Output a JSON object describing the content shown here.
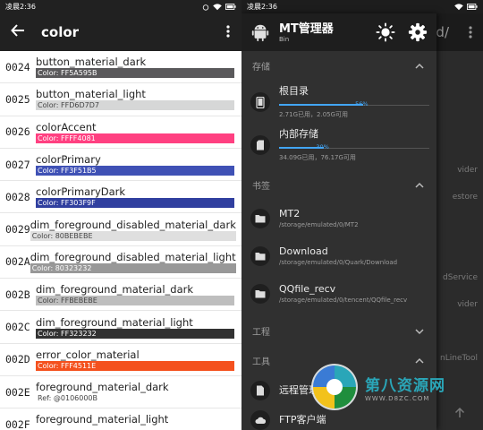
{
  "left": {
    "status": {
      "time": "凌晨2:36",
      "battery": "▮"
    },
    "toolbar": {
      "title": "color"
    },
    "rows": [
      {
        "code": "0024",
        "name": "button_material_dark",
        "label": "Color: FF5A595B",
        "color": "#5A595B"
      },
      {
        "code": "0025",
        "name": "button_material_light",
        "label": "Color: FFD6D7D7",
        "color": "#D6D7D7",
        "dark": true
      },
      {
        "code": "0026",
        "name": "colorAccent",
        "label": "Color: FFFF4081",
        "color": "#FF4081"
      },
      {
        "code": "0027",
        "name": "colorPrimary",
        "label": "Color: FF3F51B5",
        "color": "#3F51B5"
      },
      {
        "code": "0028",
        "name": "colorPrimaryDark",
        "label": "Color: FF303F9F",
        "color": "#303F9F"
      },
      {
        "code": "0029",
        "name": "dim_foreground_disabled_material_dark",
        "label": "Color: 80BEBEBE",
        "color": "#DFDFDF",
        "dark": true
      },
      {
        "code": "002A",
        "name": "dim_foreground_disabled_material_light",
        "label": "Color: 80323232",
        "color": "#989898"
      },
      {
        "code": "002B",
        "name": "dim_foreground_material_dark",
        "label": "Color: FFBEBEBE",
        "color": "#BEBEBE",
        "dark": true
      },
      {
        "code": "002C",
        "name": "dim_foreground_material_light",
        "label": "Color: FF323232",
        "color": "#323232"
      },
      {
        "code": "002D",
        "name": "error_color_material",
        "label": "Color: FFF4511E",
        "color": "#F4511E"
      },
      {
        "code": "002E",
        "name": "foreground_material_dark",
        "label": "Ref: @0106000B",
        "color": "transparent",
        "dark": true
      },
      {
        "code": "002F",
        "name": "foreground_material_light",
        "label": "",
        "color": "transparent"
      }
    ]
  },
  "right": {
    "status": {
      "time": "凌晨2:36"
    },
    "bg_title_fragment": "d/",
    "bg_fragments": [
      "vider",
      "estore",
      "dService",
      "vider",
      "nLineTool"
    ],
    "header": {
      "app_name": "MT管理器",
      "app_sub": "Bin"
    },
    "sections": {
      "storage": "存储",
      "bookmarks": "书签",
      "project": "工程",
      "tools": "工具"
    },
    "storage": [
      {
        "title": "根目录",
        "sub": "2.71G已用，2.05G可用",
        "percent": 56,
        "pct_label": "56%"
      },
      {
        "title": "内部存储",
        "sub": "34.09G已用，76.17G可用",
        "percent": 30,
        "pct_label": "30%"
      }
    ],
    "bookmarks": [
      {
        "title": "MT2",
        "path": "/storage/emulated/0/MT2"
      },
      {
        "title": "Download",
        "path": "/storage/emulated/0/Quark/Download"
      },
      {
        "title": "QQfile_recv",
        "path": "/storage/emulated/0/tencent/QQfile_recv"
      }
    ],
    "tools": [
      {
        "title": "远程管理"
      },
      {
        "title": "FTP客户端"
      }
    ],
    "watermark": {
      "main": "第八资源网",
      "url": "WWW.D8ZC.COM"
    }
  }
}
